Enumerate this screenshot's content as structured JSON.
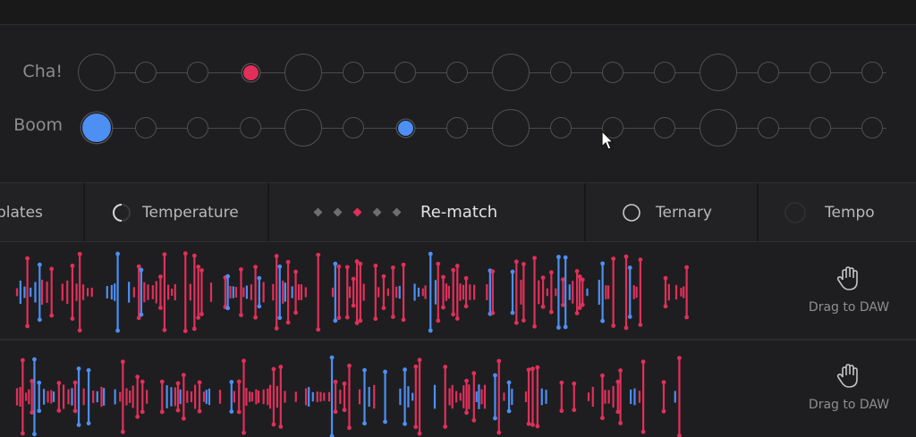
{
  "sequencer": {
    "tracks": [
      {
        "name": "Cha!",
        "active_step": 3,
        "active_color": "#e0305a"
      },
      {
        "name": "Boom",
        "active_steps": [
          0,
          6
        ],
        "active_color": "#4d8ff2"
      }
    ],
    "steps_per_track": 16
  },
  "tabs": [
    {
      "label": "plates",
      "icon": "none"
    },
    {
      "label": "Temperature",
      "icon": "arc-knob-icon"
    },
    {
      "label": "Re-match",
      "icon": "dots-slider-icon",
      "dots": 5,
      "active_dot": 2
    },
    {
      "label": "Ternary",
      "icon": "circle-icon"
    },
    {
      "label": "Tempo",
      "icon": "dial-icon"
    }
  ],
  "clips": [
    {
      "drag_label": "Drag to DAW",
      "drag_icon": "hand-icon"
    },
    {
      "drag_label": "Drag to DAW",
      "drag_icon": "hand-icon"
    }
  ],
  "colors": {
    "red": "#e0305a",
    "blue": "#4d8ff2",
    "background": "#1e1e20"
  }
}
